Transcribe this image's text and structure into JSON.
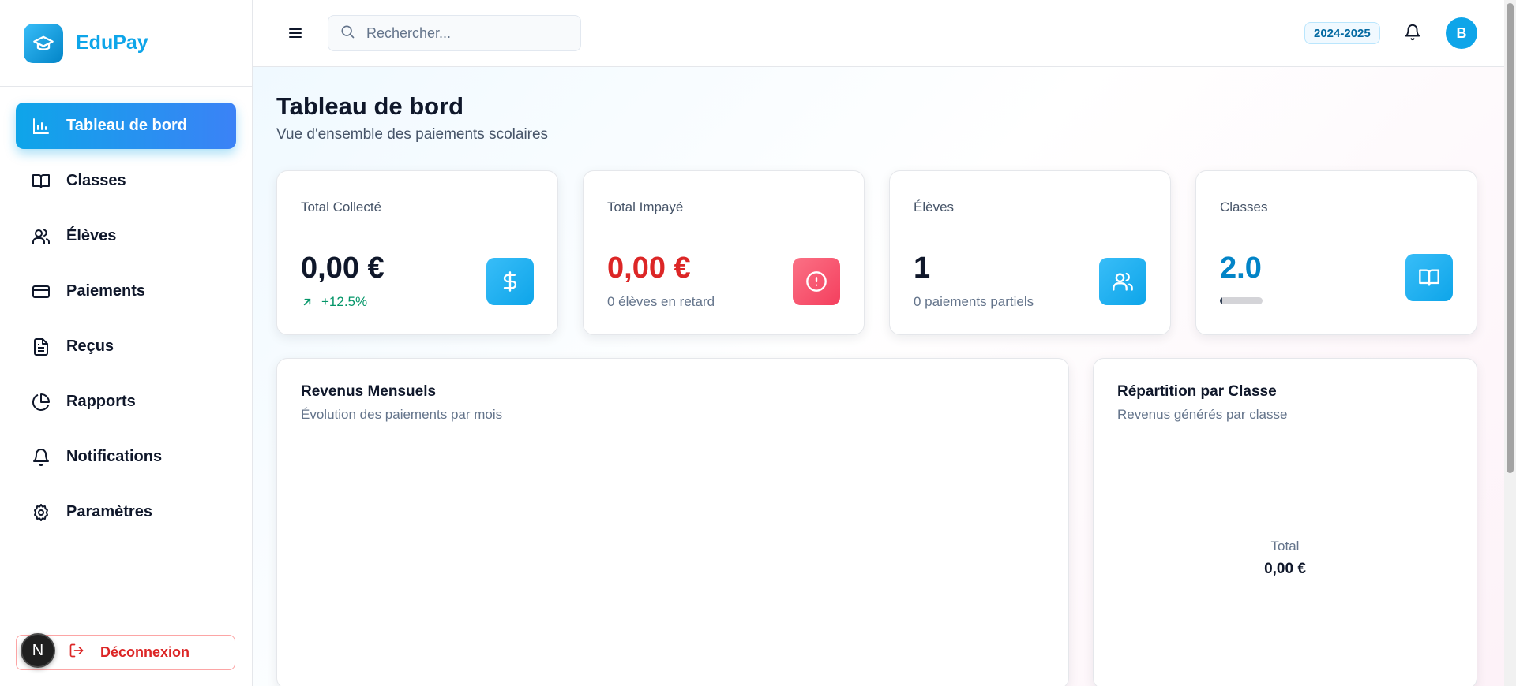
{
  "brand": {
    "name": "EduPay"
  },
  "sidebar": {
    "items": [
      {
        "label": "Tableau de bord",
        "icon": "bar-chart-icon",
        "active": true
      },
      {
        "label": "Classes",
        "icon": "book-open-icon"
      },
      {
        "label": "Élèves",
        "icon": "users-icon"
      },
      {
        "label": "Paiements",
        "icon": "credit-card-icon"
      },
      {
        "label": "Reçus",
        "icon": "file-text-icon"
      },
      {
        "label": "Rapports",
        "icon": "pie-chart-icon"
      },
      {
        "label": "Notifications",
        "icon": "bell-icon"
      },
      {
        "label": "Paramètres",
        "icon": "gear-icon"
      }
    ],
    "logout_label": "Déconnexion",
    "dev_badge": "N"
  },
  "header": {
    "search_placeholder": "Rechercher...",
    "year_badge": "2024-2025",
    "avatar_initial": "B"
  },
  "page": {
    "title": "Tableau de bord",
    "subtitle": "Vue d'ensemble des paiements scolaires"
  },
  "stats": [
    {
      "label": "Total Collecté",
      "value": "0,00 €",
      "trend": "+12.5%",
      "icon": "dollar-icon",
      "color": "#0ea5e9"
    },
    {
      "label": "Total Impayé",
      "value": "0,00 €",
      "sub": "0 élèves en retard",
      "icon": "alert-circle-icon",
      "color": "#dc2626"
    },
    {
      "label": "Élèves",
      "value": "1",
      "sub": "0 paiements partiels",
      "icon": "users-icon",
      "color": "#0ea5e9"
    },
    {
      "label": "Classes",
      "value": "2.0",
      "progress": 0.05,
      "icon": "book-open-icon",
      "color": "#0284c7"
    }
  ],
  "charts": {
    "monthly": {
      "title": "Revenus Mensuels",
      "subtitle": "Évolution des paiements par mois"
    },
    "by_class": {
      "title": "Répartition par Classe",
      "subtitle": "Revenus générés par classe",
      "total_label": "Total",
      "total_value": "0,00 €"
    }
  },
  "colors": {
    "accent": "#0ea5e9",
    "danger": "#dc2626",
    "success": "#059669"
  }
}
